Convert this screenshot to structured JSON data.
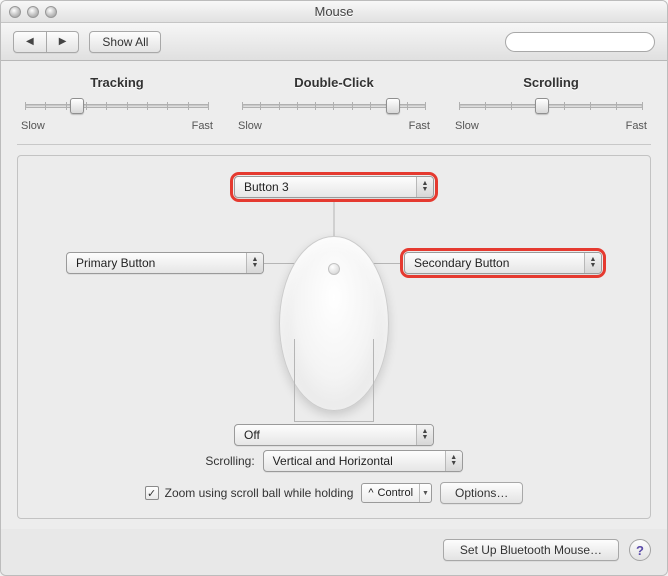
{
  "window": {
    "title": "Mouse"
  },
  "toolbar": {
    "show_all": "Show All",
    "search_placeholder": ""
  },
  "sliders": {
    "tracking": {
      "title": "Tracking",
      "slow": "Slow",
      "fast": "Fast",
      "value_pct": 28,
      "ticks": 10
    },
    "double_click": {
      "title": "Double-Click",
      "slow": "Slow",
      "fast": "Fast",
      "value_pct": 82,
      "ticks": 11
    },
    "scrolling": {
      "title": "Scrolling",
      "slow": "Slow",
      "fast": "Fast",
      "value_pct": 45,
      "ticks": 8
    }
  },
  "buttons": {
    "top": "Button 3",
    "left": "Primary Button",
    "right": "Secondary Button",
    "side": "Off"
  },
  "scrolling_row": {
    "label": "Scrolling:",
    "value": "Vertical and Horizontal"
  },
  "zoom": {
    "checked": true,
    "label": "Zoom using scroll ball while holding",
    "modifier_symbol": "^",
    "modifier_name": "Control",
    "options_label": "Options…"
  },
  "footer": {
    "setup": "Set Up Bluetooth Mouse…"
  }
}
